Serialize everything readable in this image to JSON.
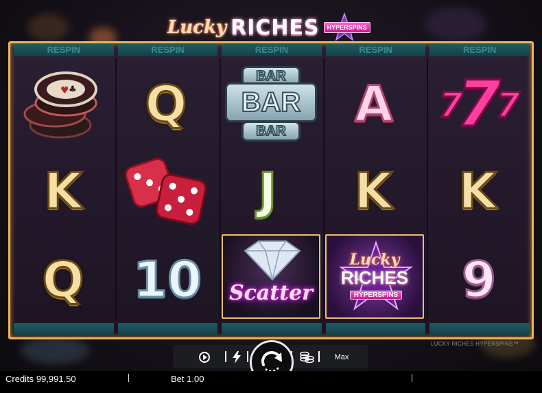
{
  "logo": {
    "lucky": "Lucky",
    "riches": "RICHES",
    "badge": "HYPERSPINS"
  },
  "respin_label": "RESPIN",
  "reels": [
    [
      "casino-chips",
      "Q",
      "K"
    ],
    [
      "Q",
      "dice",
      "10"
    ],
    [
      "BAR",
      "J",
      "Scatter"
    ],
    [
      "A",
      "K",
      "Lucky Riches wild"
    ],
    [
      "7",
      "K",
      "9"
    ]
  ],
  "symbols": {
    "bar_top": "BAR",
    "bar_mid": "BAR",
    "bar_bottom": "BAR",
    "scatter": "Scatter",
    "wild_lucky": "Lucky",
    "wild_riches": "RICHES",
    "wild_badge": "HYPERSPINS",
    "q1": "Q",
    "k1": "K",
    "q2": "Q",
    "ten": "10",
    "j": "J",
    "a": "A",
    "k2": "K",
    "seven": "7",
    "k3": "K",
    "nine": "9"
  },
  "game_title_footer": "LUCKY RICHES HYPERSPINS™",
  "controls": {
    "max_label": "Max"
  },
  "status": {
    "credits_label": "Credits",
    "credits_value": "99,991.50",
    "bet_label": "Bet",
    "bet_value": "1.00"
  },
  "colors": {
    "frame_gold": "#e9b35a",
    "respin_teal": "#1f5c63",
    "background": "#1c1423"
  }
}
